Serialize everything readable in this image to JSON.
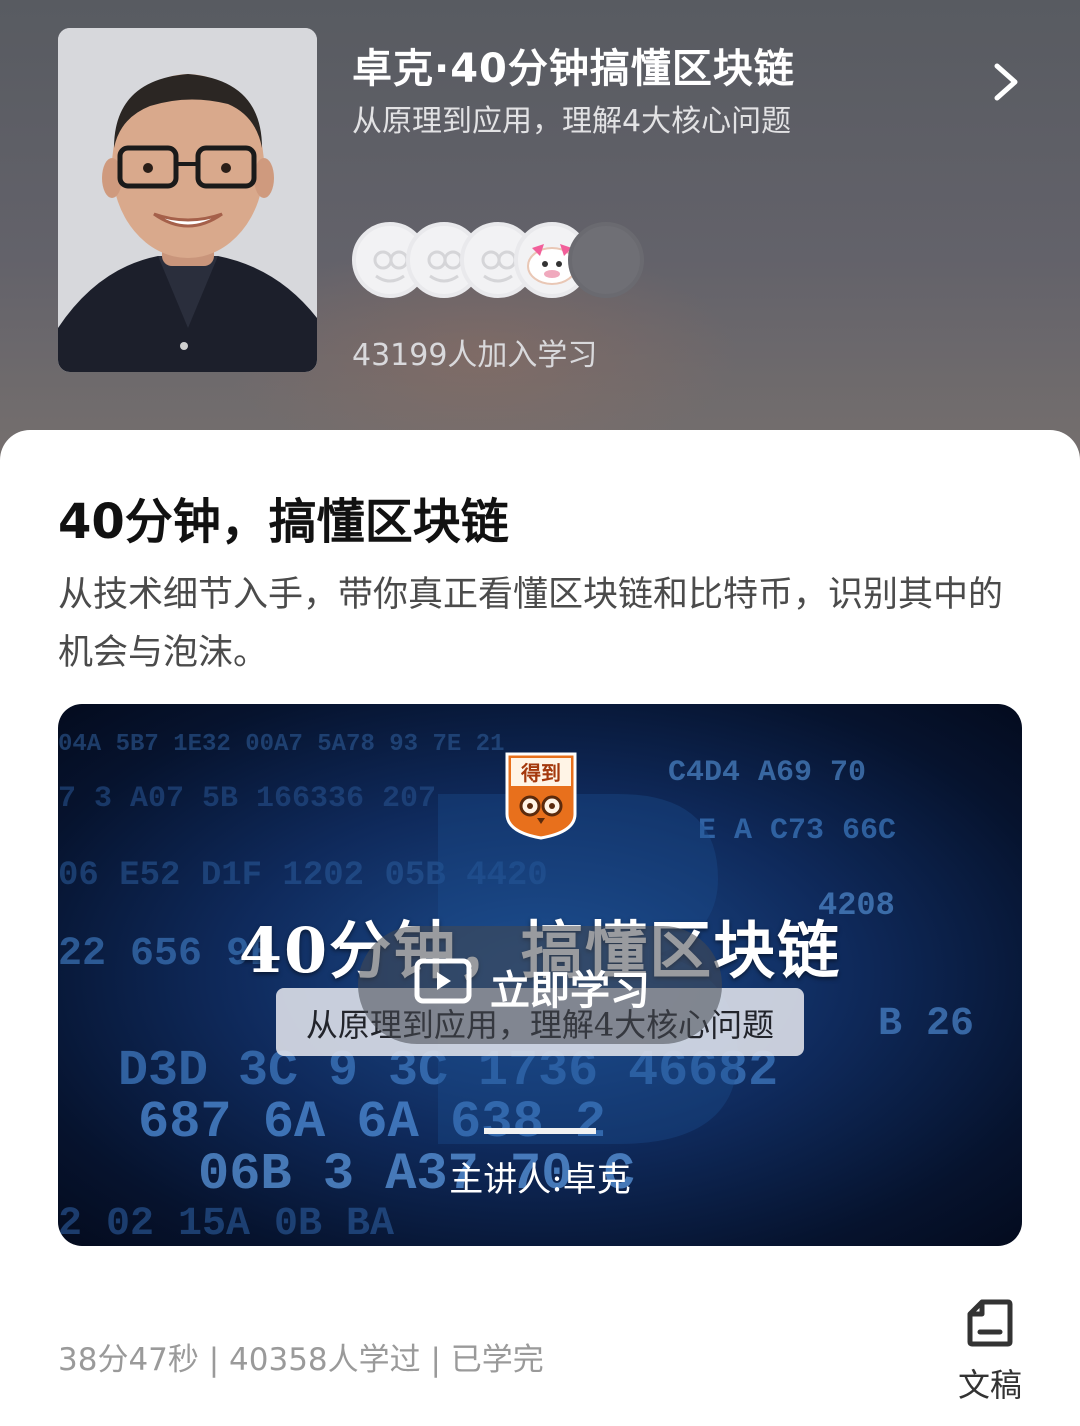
{
  "header": {
    "course_title": "卓克·40分钟搞懂区块链",
    "course_subtitle": "从原理到应用，理解4大核心问题",
    "learners": "43199人加入学习"
  },
  "lesson": {
    "title": "40分钟，搞懂区块链",
    "description": "从技术细节入手，带你真正看懂区块链和比特币，识别其中的机会与泡沫。"
  },
  "video": {
    "logo_text": "得到",
    "title": "40分钟，搞懂区块链",
    "subtitle": "从原理到应用，理解4大核心问题",
    "play_label": "立即学习",
    "speaker": "主讲人:卓克"
  },
  "footer": {
    "meta": "38分47秒 | 40358人学过 | 已学完",
    "doc_label": "文稿"
  },
  "icons": [
    "chevron-right-icon",
    "play-icon",
    "document-icon"
  ],
  "colors": {
    "header_bg": "#5f6066",
    "card_bg": "#ffffff",
    "video_bg": "#0f2a5c",
    "logo_orange": "#e8701c"
  }
}
